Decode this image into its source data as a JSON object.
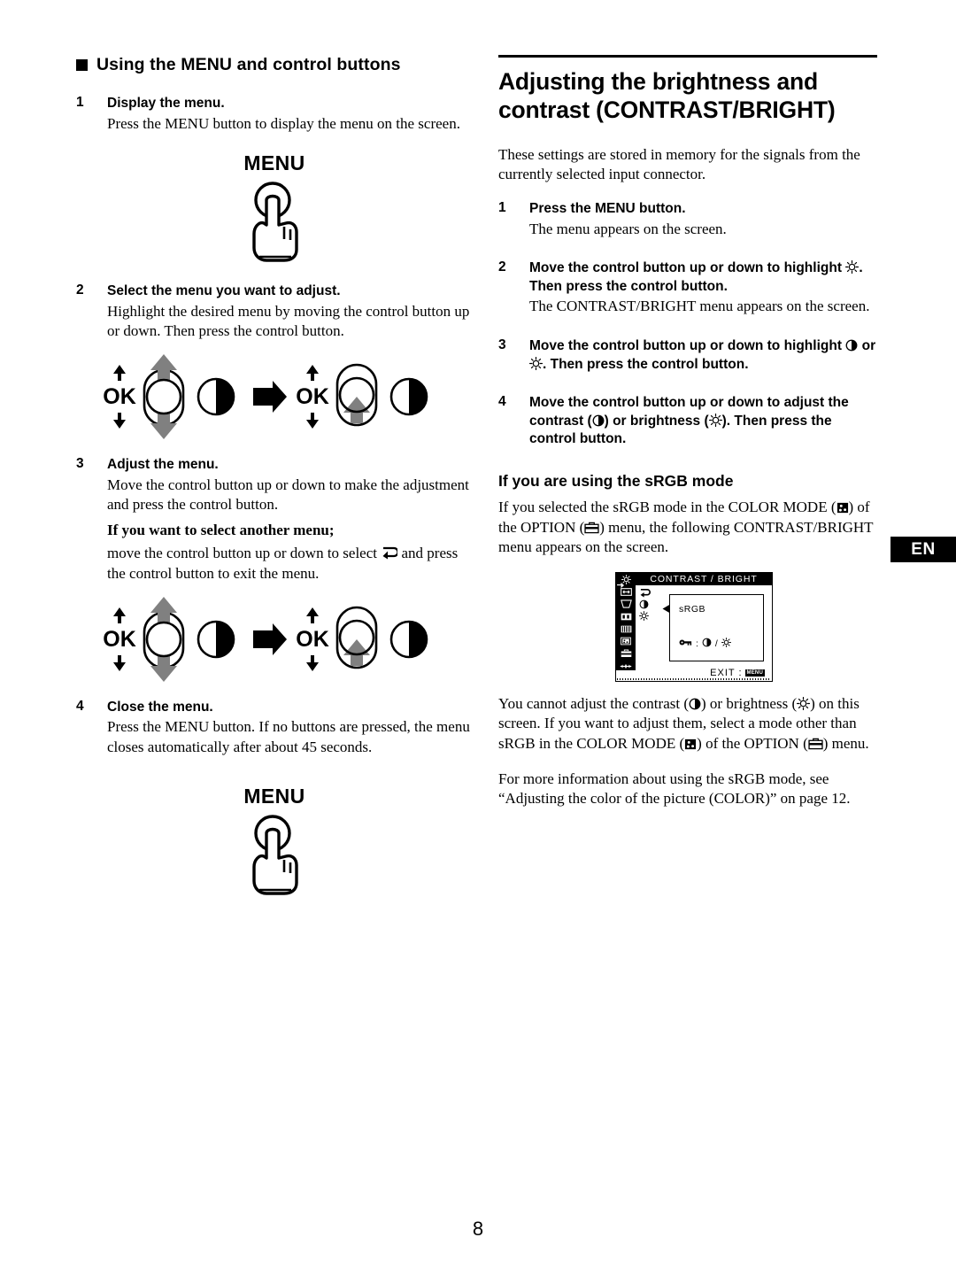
{
  "page_number": "8",
  "language_tab": "EN",
  "left_column": {
    "section_heading": "Using the MENU and control buttons",
    "steps": [
      {
        "num": "1",
        "title": "Display the menu.",
        "body": "Press the MENU button to display the menu on the screen."
      },
      {
        "num": "2",
        "title": "Select the menu you want to adjust.",
        "body": "Highlight the desired menu by moving the control button up or down. Then press the control button."
      },
      {
        "num": "3",
        "title": "Adjust the menu.",
        "body": "Move the control button up or down to make the adjustment and press the control button.",
        "subhead": "If you want to select another menu;",
        "body2_before": "move the control button up or down to select",
        "body2_after": "and press the control button to exit the menu."
      },
      {
        "num": "4",
        "title": "Close the menu.",
        "body": "Press the MENU button. If no buttons are pressed, the menu closes automatically after about 45 seconds."
      }
    ],
    "menu_label": "MENU",
    "ok_label": "OK"
  },
  "right_column": {
    "title": "Adjusting the brightness and contrast (CONTRAST/BRIGHT)",
    "intro": "These settings are stored in memory for the signals from the currently selected input connector.",
    "steps": [
      {
        "num": "1",
        "title": "Press the MENU button.",
        "body": "The menu appears on the screen."
      },
      {
        "num": "2",
        "title_a": "Move the control button up or down to highlight",
        "title_b": ". Then press the control button.",
        "body": "The CONTRAST/BRIGHT menu appears on the screen."
      },
      {
        "num": "3",
        "title_a": "Move the control button up or down to highlight",
        "title_b": "or",
        "title_c": ". Then press the control button."
      },
      {
        "num": "4",
        "title_a": "Move the control button up or down to adjust the contrast (",
        "title_b": ") or brightness (",
        "title_c": "). Then press the control button."
      }
    ],
    "srgb_heading": "If you are using the sRGB mode",
    "srgb_para_1a": "If you selected the sRGB mode in the COLOR MODE (",
    "srgb_para_1b": ") of the OPTION (",
    "srgb_para_1c": ") menu, the following CONTRAST/BRIGHT menu appears on the screen.",
    "srgb_para_2a": "You cannot adjust the contrast (",
    "srgb_para_2b": ") or brightness (",
    "srgb_para_2c": ") on this screen. If you want to adjust them, select a mode other than sRGB in the COLOR MODE (",
    "srgb_para_2d": ") of the OPTION (",
    "srgb_para_2e": ") menu.",
    "srgb_para_3": "For more information about using the sRGB mode, see “Adjusting the color of the picture (COLOR)” on page 12."
  },
  "osd": {
    "title": "CONTRAST / BRIGHT",
    "mode_label": "sRGB",
    "lock_row_text": ":",
    "lock_separator": "/",
    "exit_label": "EXIT :",
    "exit_badge": "MENU"
  }
}
